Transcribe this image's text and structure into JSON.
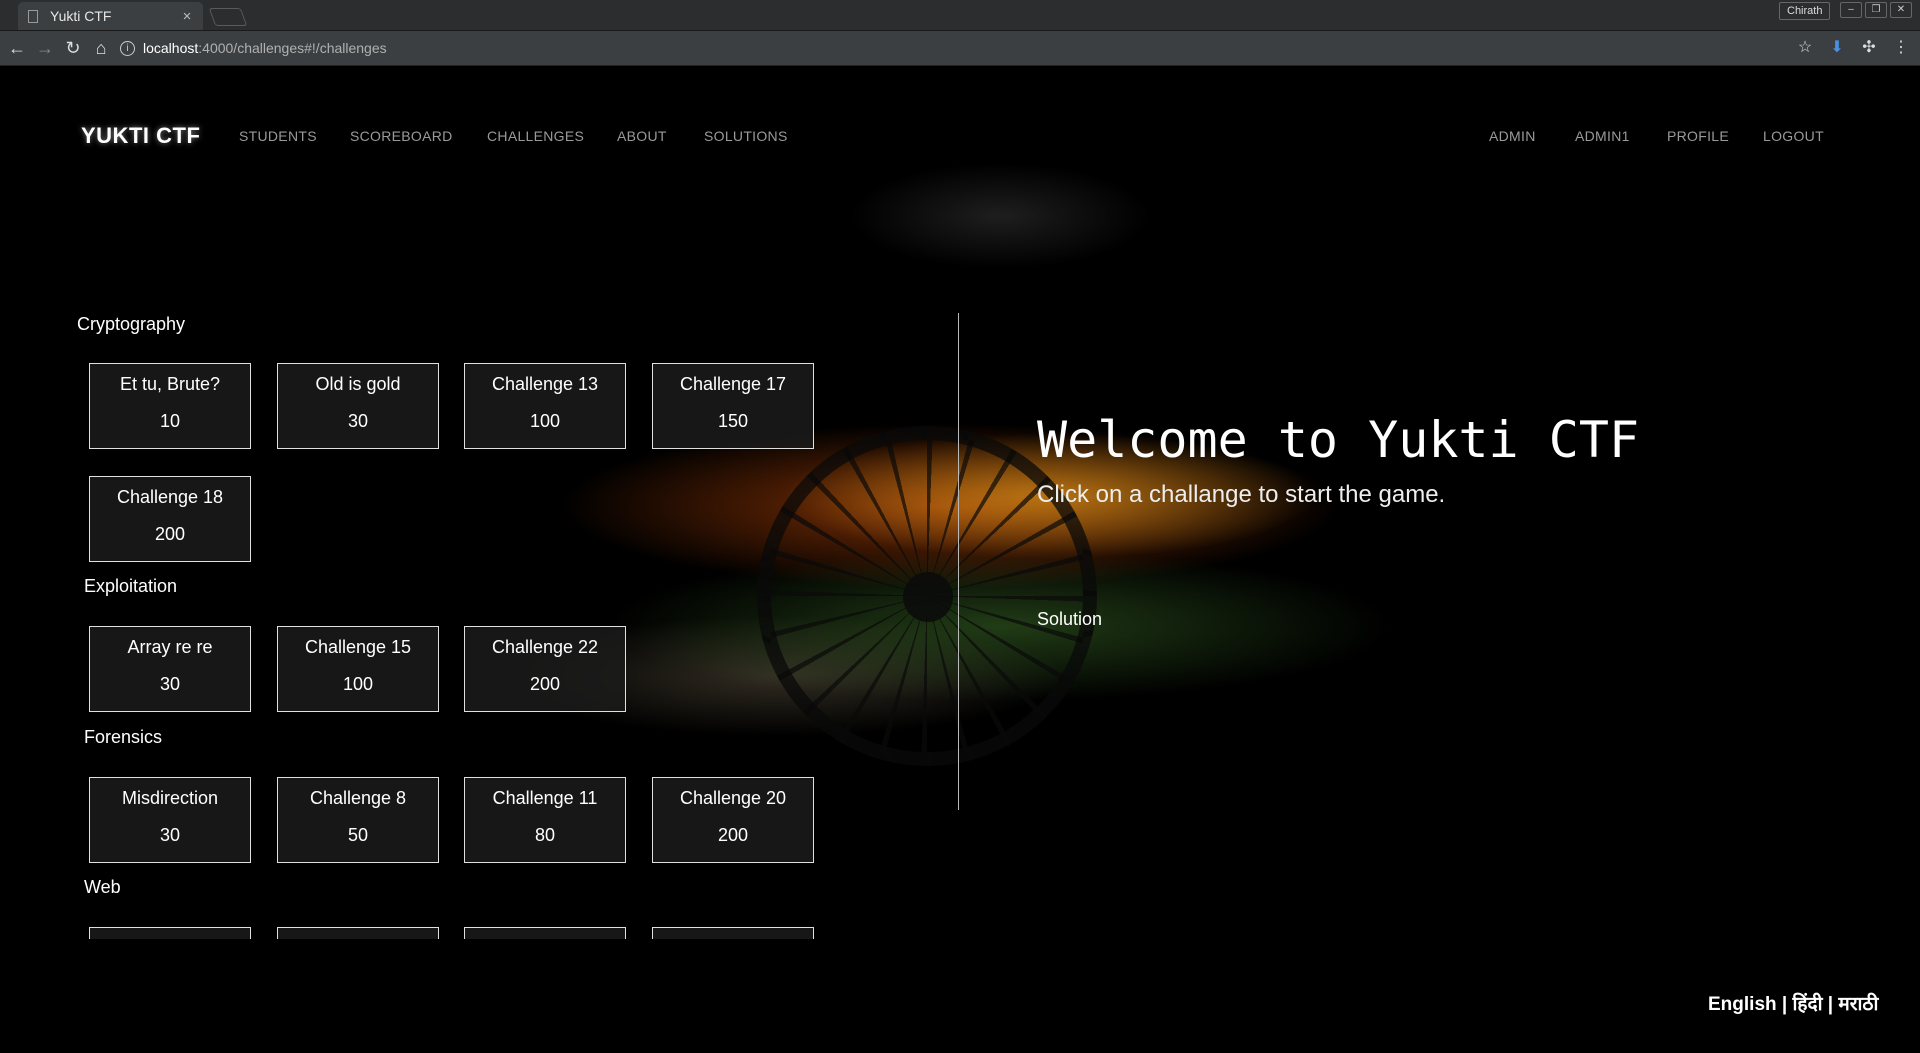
{
  "browser": {
    "tab_title": "Yukti CTF",
    "tab_close": "×",
    "url_host": "localhost",
    "url_path": ":4000/challenges#!/challenges",
    "profile_name": "Chirath"
  },
  "navbar": {
    "brand": "YUKTI CTF",
    "left_links": [
      "STUDENTS",
      "SCOREBOARD",
      "CHALLENGES",
      "ABOUT",
      "SOLUTIONS"
    ],
    "right_links": [
      "ADMIN",
      "ADMIN1",
      "PROFILE",
      "LOGOUT"
    ]
  },
  "categories": [
    {
      "name": "Cryptography",
      "challenges": [
        {
          "name": "Et tu, Brute?",
          "points": "10"
        },
        {
          "name": "Old is gold",
          "points": "30"
        },
        {
          "name": "Challenge 13",
          "points": "100"
        },
        {
          "name": "Challenge 17",
          "points": "150"
        },
        {
          "name": "Challenge 18",
          "points": "200"
        }
      ]
    },
    {
      "name": "Exploitation",
      "challenges": [
        {
          "name": "Array re re",
          "points": "30"
        },
        {
          "name": "Challenge 15",
          "points": "100"
        },
        {
          "name": "Challenge 22",
          "points": "200"
        }
      ]
    },
    {
      "name": "Forensics",
      "challenges": [
        {
          "name": "Misdirection",
          "points": "30"
        },
        {
          "name": "Challenge 8",
          "points": "50"
        },
        {
          "name": "Challenge 11",
          "points": "80"
        },
        {
          "name": "Challenge 20",
          "points": "200"
        }
      ]
    },
    {
      "name": "Web",
      "challenges": [
        {
          "name": "",
          "points": ""
        },
        {
          "name": "",
          "points": ""
        },
        {
          "name": "",
          "points": ""
        },
        {
          "name": "",
          "points": ""
        }
      ]
    }
  ],
  "panel": {
    "welcome": "Welcome to Yukti CTF",
    "subtitle": "Click on a challange to start the game.",
    "solution": "Solution"
  },
  "language_switcher": "English | हिंदी | मराठी"
}
